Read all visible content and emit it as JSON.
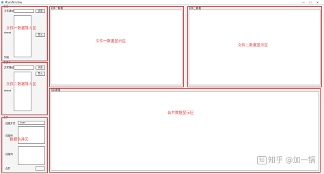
{
  "window": {
    "title": "MainWindow",
    "controls": [
      "—",
      "☐",
      "✕"
    ]
  },
  "left": {
    "file1": {
      "group_title": "文件一",
      "file_label": "文件路径",
      "browse": "浏览",
      "sheet_label": "sheet",
      "import": "导入",
      "column_label": "列名",
      "overlay": "文件一数据导入区"
    },
    "file2": {
      "group_title": "文件二",
      "file_label": "文件路径",
      "browse": "浏览",
      "sheet_label": "sheet",
      "import": "导入",
      "overlay": "文件二数据导入区"
    },
    "merge": {
      "group_title": "合并",
      "mode_label": "连接方式",
      "mode_value": "inner",
      "left_label": "连接列",
      "right_label": "连接列",
      "run": "合并",
      "overlay": "数据合并区"
    }
  },
  "panels": {
    "file1": {
      "title": "文件一数据",
      "overlay": "文件一数据显示区"
    },
    "file2": {
      "title": "文件二数据",
      "overlay": "文件二数据显示区"
    },
    "merged": {
      "title": "合并数据",
      "overlay": "合并数据显示区"
    }
  },
  "watermark": {
    "logo": "知",
    "text": "知乎 @加一锅"
  }
}
